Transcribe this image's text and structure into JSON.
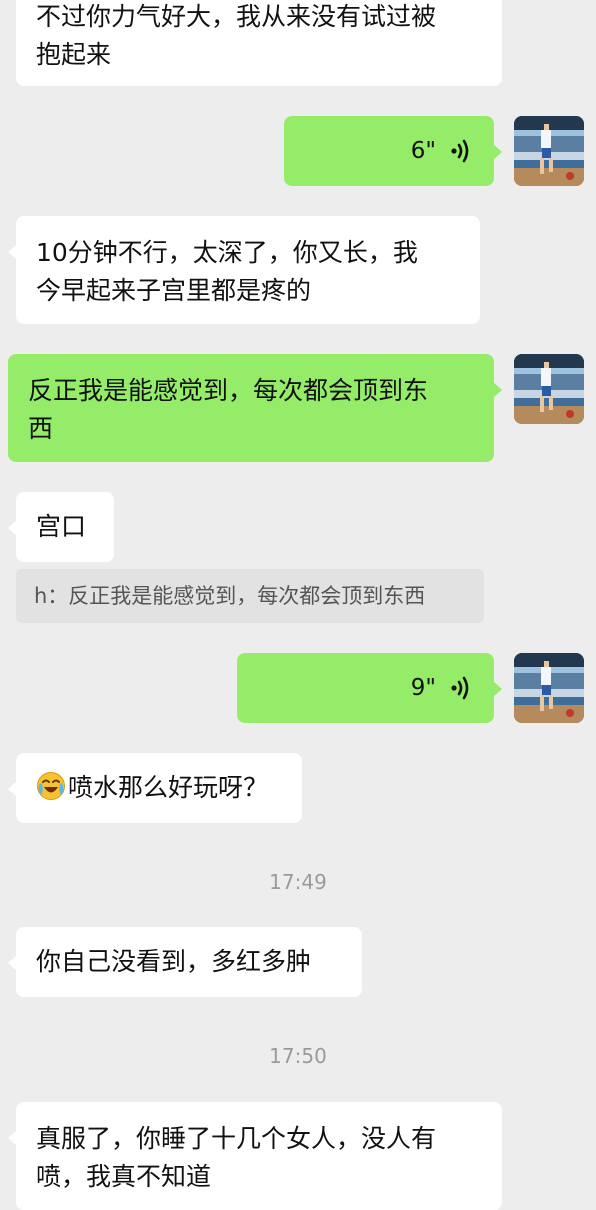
{
  "messages": [
    {
      "side": "in",
      "text_line1": "不过你力气好大，我从来没有试过被",
      "text_line2": "抱起来"
    },
    {
      "side": "out",
      "type": "voice",
      "duration": "6\""
    },
    {
      "side": "in",
      "text_line1": "10分钟不行，太深了，你又长，我",
      "text_line2": "今早起来子宫里都是疼的"
    },
    {
      "side": "out",
      "text_line1": "反正我是能感觉到，每次都会顶到东",
      "text_line2": "西"
    },
    {
      "side": "in",
      "text": "宫口"
    },
    {
      "type": "quote",
      "text": "h：反正我是能感觉到，每次都会顶到东西"
    },
    {
      "side": "out",
      "type": "voice",
      "duration": "9\""
    },
    {
      "side": "in",
      "emoji": "crying-laughing-emoji",
      "text": "喷水那么好玩呀？"
    },
    {
      "type": "timestamp",
      "text": "17:49"
    },
    {
      "side": "in",
      "text": "你自己没看到，多红多肿"
    },
    {
      "type": "timestamp",
      "text": "17:50"
    },
    {
      "side": "in",
      "text_line1": "真服了，你睡了十几个女人，没人有",
      "text_line2": "喷，我真不知道"
    }
  ],
  "colors": {
    "background": "#ededed",
    "incoming_bubble": "#ffffff",
    "outgoing_bubble": "#95ec69",
    "quote_bg": "#e2e2e2",
    "timestamp": "#9a9a9a"
  },
  "icons": {
    "voice": "voice-wave-icon",
    "avatar": "basketball-player-avatar"
  }
}
